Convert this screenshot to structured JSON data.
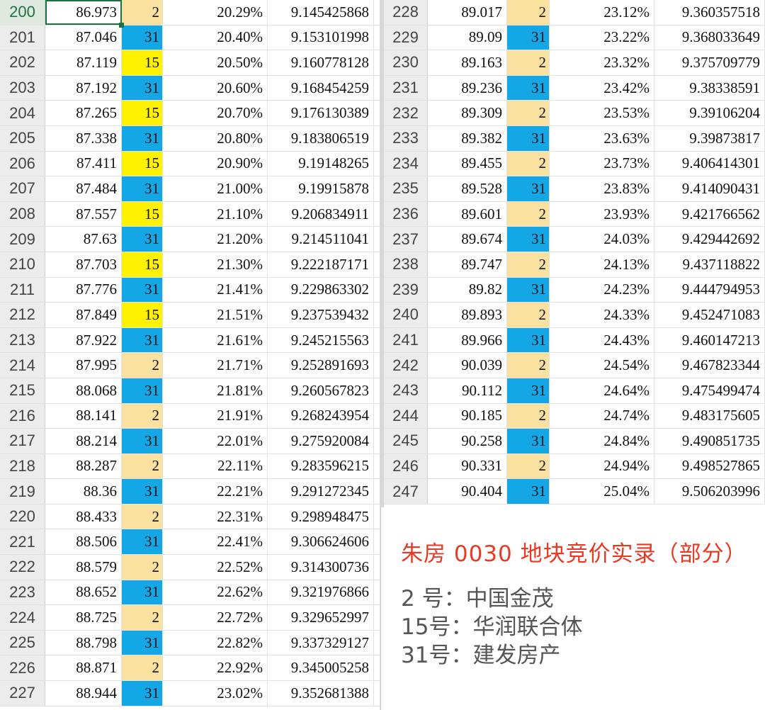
{
  "left_rows": [
    {
      "row": "200",
      "price": "86.973",
      "bidder": "2",
      "pct": "20.29%",
      "ratio": "9.145425868"
    },
    {
      "row": "201",
      "price": "87.046",
      "bidder": "31",
      "pct": "20.40%",
      "ratio": "9.153101998"
    },
    {
      "row": "202",
      "price": "87.119",
      "bidder": "15",
      "pct": "20.50%",
      "ratio": "9.160778128"
    },
    {
      "row": "203",
      "price": "87.192",
      "bidder": "31",
      "pct": "20.60%",
      "ratio": "9.168454259"
    },
    {
      "row": "204",
      "price": "87.265",
      "bidder": "15",
      "pct": "20.70%",
      "ratio": "9.176130389"
    },
    {
      "row": "205",
      "price": "87.338",
      "bidder": "31",
      "pct": "20.80%",
      "ratio": "9.183806519"
    },
    {
      "row": "206",
      "price": "87.411",
      "bidder": "15",
      "pct": "20.90%",
      "ratio": "9.19148265"
    },
    {
      "row": "207",
      "price": "87.484",
      "bidder": "31",
      "pct": "21.00%",
      "ratio": "9.19915878"
    },
    {
      "row": "208",
      "price": "87.557",
      "bidder": "15",
      "pct": "21.10%",
      "ratio": "9.206834911"
    },
    {
      "row": "209",
      "price": "87.63",
      "bidder": "31",
      "pct": "21.20%",
      "ratio": "9.214511041"
    },
    {
      "row": "210",
      "price": "87.703",
      "bidder": "15",
      "pct": "21.30%",
      "ratio": "9.222187171"
    },
    {
      "row": "211",
      "price": "87.776",
      "bidder": "31",
      "pct": "21.41%",
      "ratio": "9.229863302"
    },
    {
      "row": "212",
      "price": "87.849",
      "bidder": "15",
      "pct": "21.51%",
      "ratio": "9.237539432"
    },
    {
      "row": "213",
      "price": "87.922",
      "bidder": "31",
      "pct": "21.61%",
      "ratio": "9.245215563"
    },
    {
      "row": "214",
      "price": "87.995",
      "bidder": "2",
      "pct": "21.71%",
      "ratio": "9.252891693"
    },
    {
      "row": "215",
      "price": "88.068",
      "bidder": "31",
      "pct": "21.81%",
      "ratio": "9.260567823"
    },
    {
      "row": "216",
      "price": "88.141",
      "bidder": "2",
      "pct": "21.91%",
      "ratio": "9.268243954"
    },
    {
      "row": "217",
      "price": "88.214",
      "bidder": "31",
      "pct": "22.01%",
      "ratio": "9.275920084"
    },
    {
      "row": "218",
      "price": "88.287",
      "bidder": "2",
      "pct": "22.11%",
      "ratio": "9.283596215"
    },
    {
      "row": "219",
      "price": "88.36",
      "bidder": "31",
      "pct": "22.21%",
      "ratio": "9.291272345"
    },
    {
      "row": "220",
      "price": "88.433",
      "bidder": "2",
      "pct": "22.31%",
      "ratio": "9.298948475"
    },
    {
      "row": "221",
      "price": "88.506",
      "bidder": "31",
      "pct": "22.41%",
      "ratio": "9.306624606"
    },
    {
      "row": "222",
      "price": "88.579",
      "bidder": "2",
      "pct": "22.52%",
      "ratio": "9.314300736"
    },
    {
      "row": "223",
      "price": "88.652",
      "bidder": "31",
      "pct": "22.62%",
      "ratio": "9.321976866"
    },
    {
      "row": "224",
      "price": "88.725",
      "bidder": "2",
      "pct": "22.72%",
      "ratio": "9.329652997"
    },
    {
      "row": "225",
      "price": "88.798",
      "bidder": "31",
      "pct": "22.82%",
      "ratio": "9.337329127"
    },
    {
      "row": "226",
      "price": "88.871",
      "bidder": "2",
      "pct": "22.92%",
      "ratio": "9.345005258"
    },
    {
      "row": "227",
      "price": "88.944",
      "bidder": "31",
      "pct": "23.02%",
      "ratio": "9.352681388"
    }
  ],
  "right_rows": [
    {
      "row": "228",
      "price": "89.017",
      "bidder": "2",
      "pct": "23.12%",
      "ratio": "9.360357518"
    },
    {
      "row": "229",
      "price": "89.09",
      "bidder": "31",
      "pct": "23.22%",
      "ratio": "9.368033649"
    },
    {
      "row": "230",
      "price": "89.163",
      "bidder": "2",
      "pct": "23.32%",
      "ratio": "9.375709779"
    },
    {
      "row": "231",
      "price": "89.236",
      "bidder": "31",
      "pct": "23.42%",
      "ratio": "9.38338591"
    },
    {
      "row": "232",
      "price": "89.309",
      "bidder": "2",
      "pct": "23.53%",
      "ratio": "9.39106204"
    },
    {
      "row": "233",
      "price": "89.382",
      "bidder": "31",
      "pct": "23.63%",
      "ratio": "9.39873817"
    },
    {
      "row": "234",
      "price": "89.455",
      "bidder": "2",
      "pct": "23.73%",
      "ratio": "9.406414301"
    },
    {
      "row": "235",
      "price": "89.528",
      "bidder": "31",
      "pct": "23.83%",
      "ratio": "9.414090431"
    },
    {
      "row": "236",
      "price": "89.601",
      "bidder": "2",
      "pct": "23.93%",
      "ratio": "9.421766562"
    },
    {
      "row": "237",
      "price": "89.674",
      "bidder": "31",
      "pct": "24.03%",
      "ratio": "9.429442692"
    },
    {
      "row": "238",
      "price": "89.747",
      "bidder": "2",
      "pct": "24.13%",
      "ratio": "9.437118822"
    },
    {
      "row": "239",
      "price": "89.82",
      "bidder": "31",
      "pct": "24.23%",
      "ratio": "9.444794953"
    },
    {
      "row": "240",
      "price": "89.893",
      "bidder": "2",
      "pct": "24.33%",
      "ratio": "9.452471083"
    },
    {
      "row": "241",
      "price": "89.966",
      "bidder": "31",
      "pct": "24.43%",
      "ratio": "9.460147213"
    },
    {
      "row": "242",
      "price": "90.039",
      "bidder": "2",
      "pct": "24.54%",
      "ratio": "9.467823344"
    },
    {
      "row": "243",
      "price": "90.112",
      "bidder": "31",
      "pct": "24.64%",
      "ratio": "9.475499474"
    },
    {
      "row": "244",
      "price": "90.185",
      "bidder": "2",
      "pct": "24.74%",
      "ratio": "9.483175605"
    },
    {
      "row": "245",
      "price": "90.258",
      "bidder": "31",
      "pct": "24.84%",
      "ratio": "9.490851735"
    },
    {
      "row": "246",
      "price": "90.331",
      "bidder": "2",
      "pct": "24.94%",
      "ratio": "9.498527865"
    },
    {
      "row": "247",
      "price": "90.404",
      "bidder": "31",
      "pct": "25.04%",
      "ratio": "9.506203996"
    }
  ],
  "bidder_colors": {
    "2": "#fbe1a0",
    "15": "#fff200",
    "31": "#14a7e6"
  },
  "active_row_color": "#1e7145",
  "legend": {
    "title": "朱房 0030 地块竞价实录（部分）",
    "lines": [
      "2 号：中国金茂",
      "15号：华润联合体",
      "31号：建发房产"
    ]
  }
}
